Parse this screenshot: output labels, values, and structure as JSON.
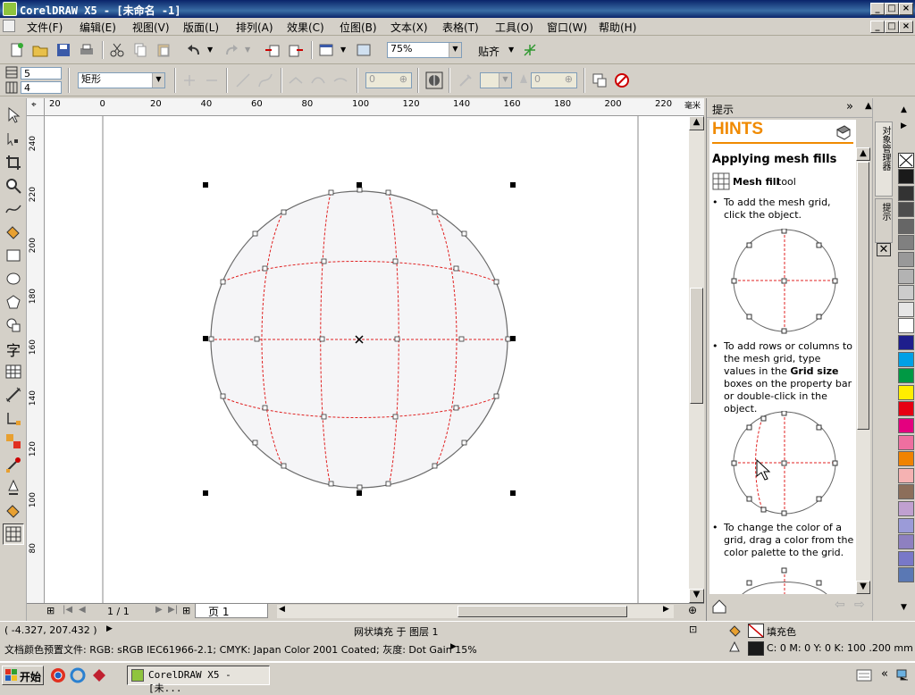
{
  "window": {
    "title": "CorelDRAW X5 - [未命名 -1]"
  },
  "menubar": {
    "items": [
      "文件(F)",
      "编辑(E)",
      "视图(V)",
      "版面(L)",
      "排列(A)",
      "效果(C)",
      "位图(B)",
      "文本(X)",
      "表格(T)",
      "工具(O)",
      "窗口(W)",
      "帮助(H)"
    ]
  },
  "toolbar": {
    "zoom": "75%",
    "snap": "贴齐"
  },
  "propbar": {
    "rows": "5",
    "cols": "4",
    "shape_mode": "矩形",
    "smoothness": "0",
    "transparency": "0"
  },
  "ruler": {
    "h_ticks": [
      "20",
      "0",
      "20",
      "40",
      "60",
      "80",
      "100",
      "120",
      "140",
      "160",
      "180",
      "200",
      "220"
    ],
    "h_unit": "毫米",
    "v_ticks": [
      "240",
      "220",
      "200",
      "180",
      "160",
      "140",
      "120",
      "100",
      "80"
    ]
  },
  "pager": {
    "count": "1 / 1",
    "tab": "页 1"
  },
  "docker": {
    "title": "提示",
    "hints_title": "HINTS",
    "heading": "Applying mesh fills",
    "tool_name": "Mesh fill",
    "tool_suffix": "tool",
    "step1": "To add the mesh grid, click the object.",
    "step2a": "To add rows or columns to the mesh grid, type values in the",
    "step2b": "Grid size",
    "step2c": "boxes on the property bar or double-click in the object.",
    "step3": "To change the color of a grid, drag a color from the color palette to the grid.",
    "tab1": "对象管理器",
    "tab2": "提示"
  },
  "palette": {
    "colors": [
      "#1a1a1a",
      "#333333",
      "#4d4d4d",
      "#666666",
      "#808080",
      "#999999",
      "#b3b3b3",
      "#cccccc",
      "#e6e6e6",
      "#ffffff",
      "#1e1e8c",
      "#00a0e6",
      "#009944",
      "#ffee00",
      "#e60012",
      "#e4007f",
      "#ee6fa0",
      "#f08300",
      "#f5b2b2",
      "#8c6e5a",
      "#c0a0d0",
      "#9b9bd8",
      "#8e80c0",
      "#7878c8",
      "#5a78b4"
    ]
  },
  "status": {
    "coords": "( -4.327, 207.432 )",
    "object_info": "网状填充 于 图层 1",
    "doc_profile": "文档颜色预置文件: RGB: sRGB IEC61966-2.1; CMYK: Japan Color 2001 Coated; 灰度: Dot Gain 15%",
    "fill_label": "填充色",
    "outline_info": "C: 0 M: 0 Y: 0 K: 100  .200 mm"
  },
  "taskbar": {
    "start": "开始",
    "task": "CorelDRAW X5 - [未..."
  }
}
